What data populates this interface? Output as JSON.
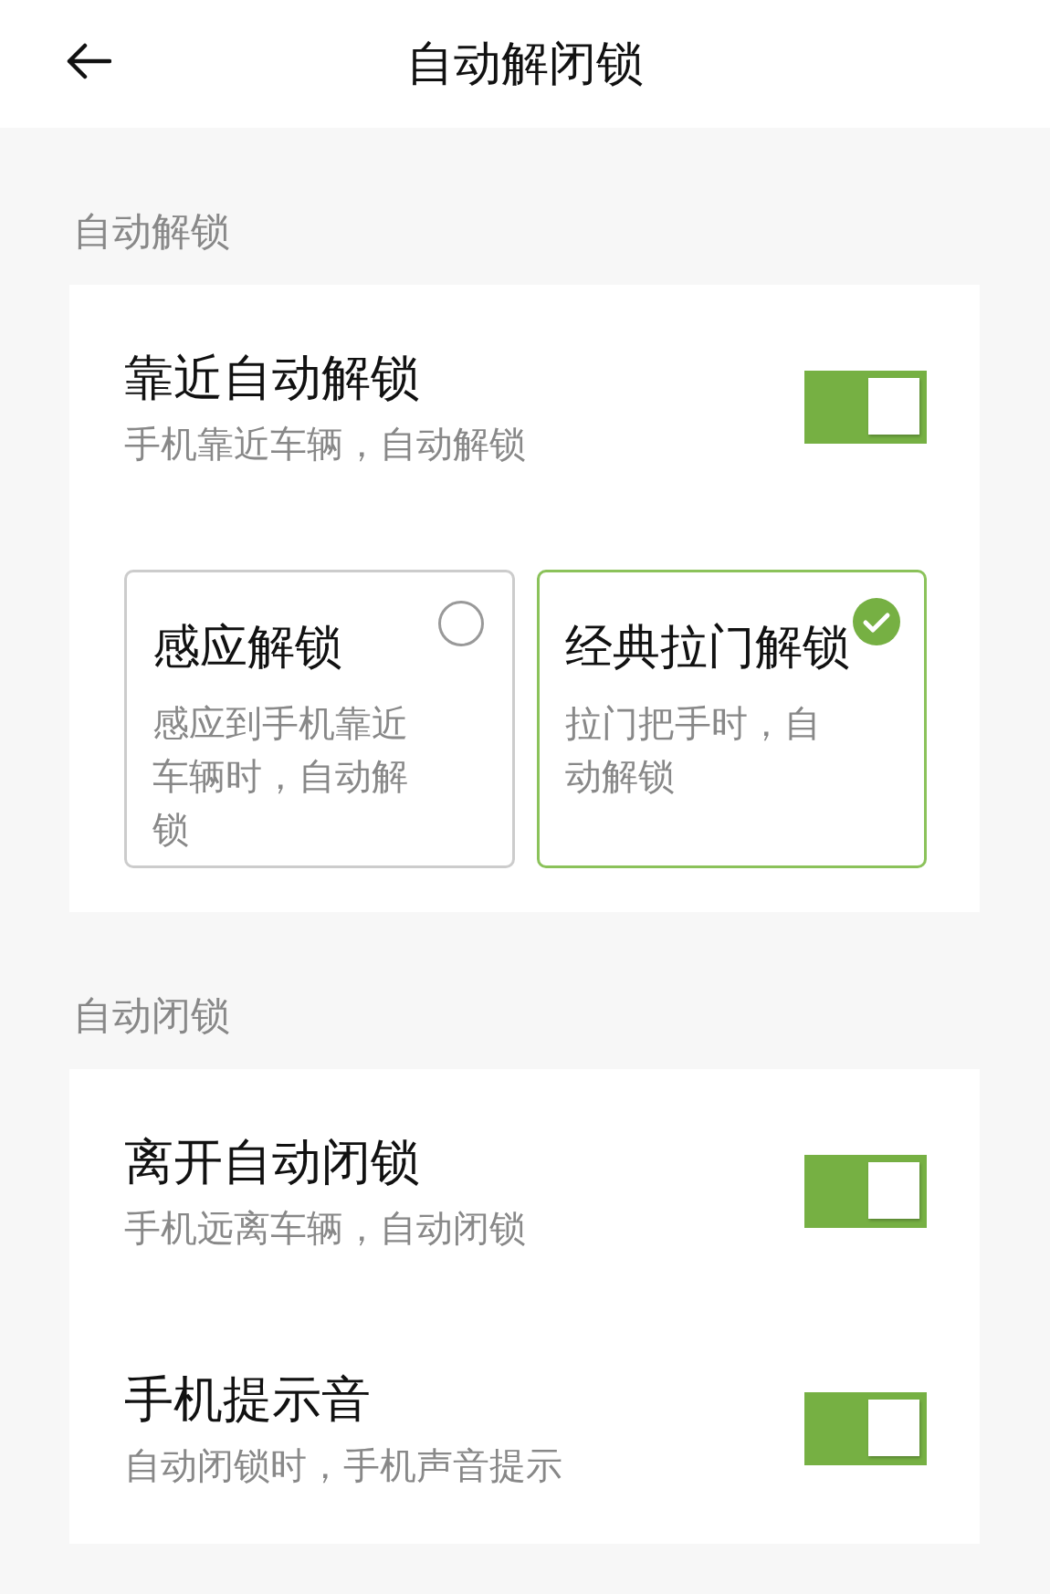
{
  "header": {
    "title": "自动解闭锁"
  },
  "sections": [
    {
      "label": "自动解锁",
      "rows": [
        {
          "title": "靠近自动解锁",
          "subtitle": "手机靠近车辆，自动解锁",
          "on": true
        }
      ],
      "options": [
        {
          "title": "感应解锁",
          "description": "感应到手机靠近车辆时，自动解锁",
          "selected": false
        },
        {
          "title": "经典拉门解锁",
          "description": "拉门把手时，自动解锁",
          "selected": true
        }
      ]
    },
    {
      "label": "自动闭锁",
      "rows": [
        {
          "title": "离开自动闭锁",
          "subtitle": "手机远离车辆，自动闭锁",
          "on": true
        },
        {
          "title": "手机提示音",
          "subtitle": "自动闭锁时，手机声音提示",
          "on": true
        }
      ]
    }
  ]
}
